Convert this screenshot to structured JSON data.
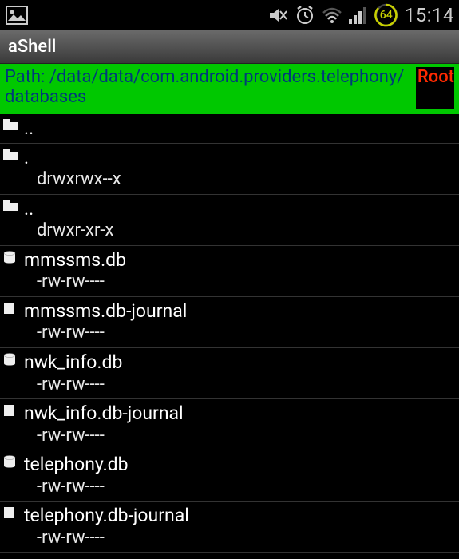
{
  "statusbar": {
    "time": "15:14",
    "battery": "64"
  },
  "titlebar": {
    "title": "aShell"
  },
  "pathbar": {
    "path": "Path: /data/data/com.android.providers.telephony/databases",
    "root_badge": "Root"
  },
  "listing": {
    "items": [
      {
        "name": "..",
        "perms": "",
        "icon": "folder"
      },
      {
        "name": ".",
        "perms": "drwxrwx--x",
        "icon": "folder"
      },
      {
        "name": "..",
        "perms": "drwxr-xr-x",
        "icon": "folder"
      },
      {
        "name": "mmssms.db",
        "perms": "-rw-rw----",
        "icon": "db"
      },
      {
        "name": "mmssms.db-journal",
        "perms": "-rw-rw----",
        "icon": "file"
      },
      {
        "name": "nwk_info.db",
        "perms": "-rw-rw----",
        "icon": "db"
      },
      {
        "name": "nwk_info.db-journal",
        "perms": "-rw-rw----",
        "icon": "file"
      },
      {
        "name": "telephony.db",
        "perms": "-rw-rw----",
        "icon": "db"
      },
      {
        "name": "telephony.db-journal",
        "perms": "-rw-rw----",
        "icon": "file"
      }
    ]
  }
}
